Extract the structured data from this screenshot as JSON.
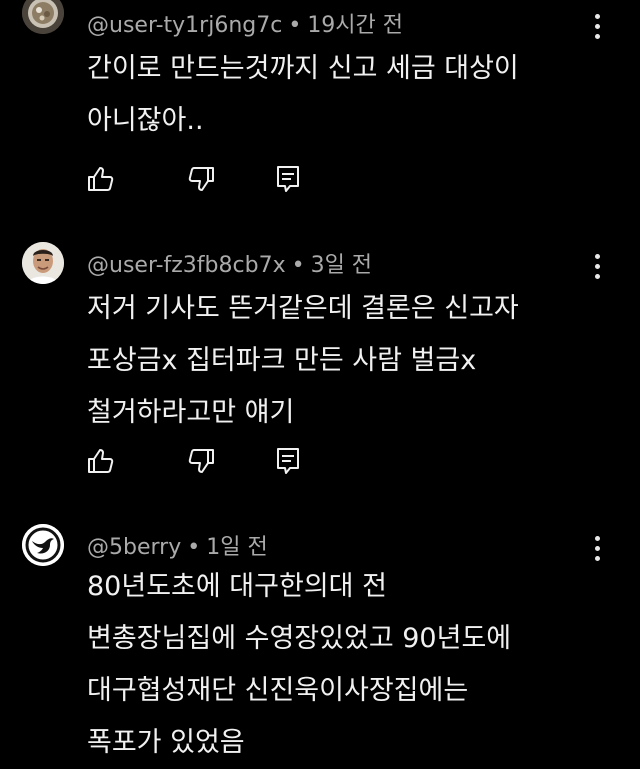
{
  "comments": [
    {
      "author": "@user-ty1rj6ng7c",
      "separator": "•",
      "time": "19시간 전",
      "lines": [
        "간이로 만드는것까지 신고 세금 대상이",
        "아니잖아.."
      ],
      "avatar_icon": "food-photo-avatar"
    },
    {
      "author": "@user-fz3fb8cb7x",
      "separator": "•",
      "time": "3일 전",
      "lines": [
        "저거 기사도 뜬거같은데 결론은 신고자",
        "포상금x 집터파크 만든 사람 벌금x",
        "철거하라고만 얘기"
      ],
      "avatar_icon": "person-photo-avatar"
    },
    {
      "author": "@5berry",
      "separator": "•",
      "time": "1일 전",
      "lines": [
        "80년도초에 대구한의대 전",
        "변총장님집에 수영장있었고 90년도에",
        "대구협성재단 신진욱이사장집에는",
        "폭포가 있었음"
      ],
      "avatar_icon": "bird-logo-avatar"
    }
  ],
  "actions": {
    "like_icon": "thumbs-up-icon",
    "dislike_icon": "thumbs-down-icon",
    "reply_icon": "reply-icon",
    "more_icon": "more-vertical-icon"
  },
  "colors": {
    "background": "#000000",
    "text": "#f1f1f1",
    "meta": "#aaaaaa"
  }
}
